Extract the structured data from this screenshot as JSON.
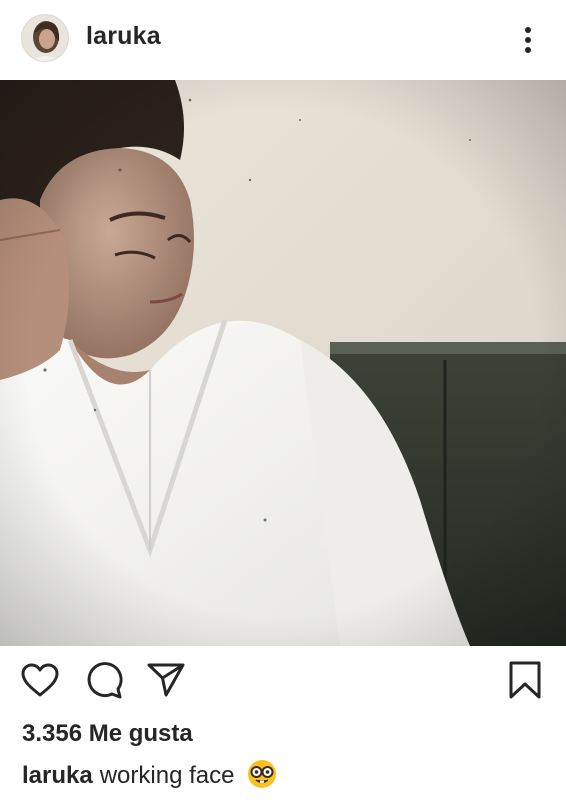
{
  "header": {
    "username": "laruka",
    "avatar_icon": "profile-photo",
    "more_icon": "more-options-icon"
  },
  "photo": {
    "icon": "post-photo"
  },
  "actions": {
    "like_icon": "heart-icon",
    "comment_icon": "comment-icon",
    "share_icon": "send-icon",
    "save_icon": "bookmark-icon"
  },
  "likes": {
    "text": "3.356 Me gusta"
  },
  "caption": {
    "username": "laruka",
    "text": "working face",
    "emoji_icon": "nerd-face-emoji"
  },
  "colors": {
    "text": "#262626",
    "background": "#ffffff",
    "emoji": "#fcc21b"
  }
}
